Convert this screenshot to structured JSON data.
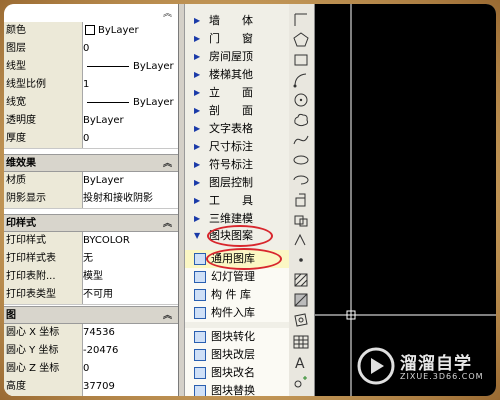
{
  "properties": {
    "general": [
      {
        "label": "颜色",
        "value": "ByLayer",
        "kind": "color"
      },
      {
        "label": "图层",
        "value": "0"
      },
      {
        "label": "线型",
        "value": "ByLayer",
        "kind": "line"
      },
      {
        "label": "线型比例",
        "value": "1"
      },
      {
        "label": "线宽",
        "value": "ByLayer",
        "kind": "line"
      },
      {
        "label": "透明度",
        "value": "ByLayer"
      },
      {
        "label": "厚度",
        "value": "0"
      }
    ],
    "effects_header": "维效果",
    "effects": [
      {
        "label": "材质",
        "value": "ByLayer"
      },
      {
        "label": "阴影显示",
        "value": "投射和接收阴影"
      }
    ],
    "print_header": "印样式",
    "print": [
      {
        "label": "打印样式",
        "value": "BYCOLOR"
      },
      {
        "label": "打印样式表",
        "value": "无"
      },
      {
        "label": "打印表附...",
        "value": "模型"
      },
      {
        "label": "打印表类型",
        "value": "不可用"
      }
    ],
    "view_header": "图",
    "view": [
      {
        "label": "圆心 X 坐标",
        "value": "74536"
      },
      {
        "label": "圆心 Y 坐标",
        "value": "-20476"
      },
      {
        "label": "圆心 Z 坐标",
        "value": "0"
      },
      {
        "label": "高度",
        "value": "37709"
      }
    ]
  },
  "menu": {
    "items": [
      "墙　　体",
      "门　　窗",
      "房间屋顶",
      "楼梯其他",
      "立　　面",
      "剖　　面",
      "文字表格",
      "尺寸标注",
      "符号标注",
      "图层控制",
      "工　　具",
      "三维建模"
    ],
    "expanded": "图块图案",
    "subitems_a": [
      "通用图库",
      "幻灯管理",
      "构 件 库",
      "构件入库"
    ],
    "subitems_b": [
      "图块转化",
      "图块改层",
      "图块改名",
      "图块替换"
    ]
  },
  "tools": [
    "wall-icon",
    "pentagon-icon",
    "rectangle-icon",
    "arc-icon",
    "polyline-arc-icon",
    "circle-icon",
    "revision-cloud-icon",
    "spline-icon",
    "ellipse-icon",
    "ellipse-arc-icon",
    "insert-block-icon",
    "make-block-icon",
    "point-icon",
    "hatch-icon",
    "gradient-icon",
    "region-icon",
    "table-icon",
    "text-icon",
    "add-selected-icon"
  ],
  "watermark": {
    "brand": "溜溜自学",
    "url": "ZIXUE.3D66.COM"
  },
  "colors": {
    "highlight_circle": "#d8262d",
    "menu_arrow": "#1a3aa8",
    "canvas": "#000000"
  }
}
